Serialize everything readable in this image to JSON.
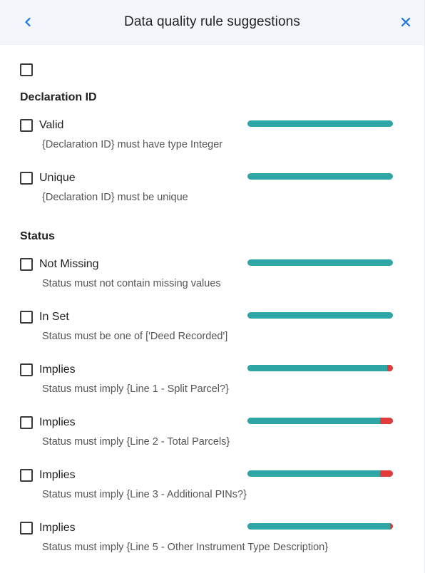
{
  "header": {
    "title": "Data quality rule suggestions",
    "back_icon": "chevron-left-icon",
    "close_icon": "close-icon",
    "accent_color": "#1a73e8"
  },
  "colors": {
    "pass": "#2ea6a6",
    "fail": "#e23b3b"
  },
  "sections": [
    {
      "title": "Declaration ID",
      "rules": [
        {
          "label": "Valid",
          "description": "{Declaration ID} must have type Integer",
          "pass_fraction": 1.0
        },
        {
          "label": "Unique",
          "description": "{Declaration ID} must be unique",
          "pass_fraction": 1.0
        }
      ]
    },
    {
      "title": "Status",
      "rules": [
        {
          "label": "Not Missing",
          "description": "Status must not contain missing values",
          "pass_fraction": 1.0
        },
        {
          "label": "In Set",
          "description": "Status must be one of ['Deed Recorded']",
          "pass_fraction": 1.0
        },
        {
          "label": "Implies",
          "description": "Status must imply {Line 1 - Split Parcel?}",
          "pass_fraction": 0.96
        },
        {
          "label": "Implies",
          "description": "Status must imply {Line 2 - Total Parcels}",
          "pass_fraction": 0.91
        },
        {
          "label": "Implies",
          "description": "Status must imply {Line 3 - Additional PINs?}",
          "pass_fraction": 0.91
        },
        {
          "label": "Implies",
          "description": "Status must imply {Line 5 - Other Instrument Type Description}",
          "pass_fraction": 0.98
        }
      ]
    }
  ]
}
